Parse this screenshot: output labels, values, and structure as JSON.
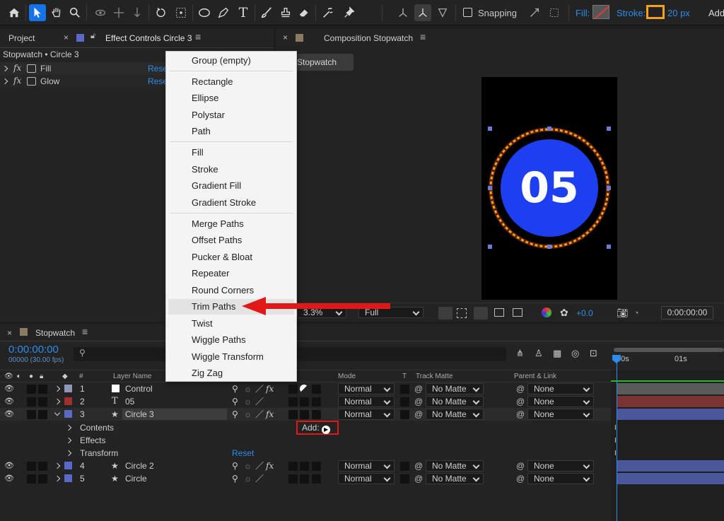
{
  "toolbar": {
    "snapping": "Snapping",
    "fill_label": "Fill:",
    "stroke_label": "Stroke:",
    "stroke_width": "20 px",
    "add_label": "Add",
    "fill_color": "#e23b3b",
    "stroke_color": "#f4a21a"
  },
  "project_panel": {
    "project_tab": "Project",
    "effect_tab": "Effect Controls Circle 3",
    "breadcrumb": "Stopwatch • Circle 3",
    "effects": [
      {
        "name": "Fill",
        "reset": "Reset"
      },
      {
        "name": "Glow",
        "reset": "Reset"
      }
    ]
  },
  "composition_panel": {
    "tab": "Composition Stopwatch",
    "sub_tab": "Stopwatch",
    "display_number": "05",
    "zoom_value": "3.3%",
    "resolution": "Full",
    "exposure": "+0.0",
    "timecode": "0:00:00:00",
    "circle_color": "#1d3ff0",
    "ring_color": "#f4a21a"
  },
  "context_menu": {
    "groups": [
      [
        "Group (empty)"
      ],
      [
        "Rectangle",
        "Ellipse",
        "Polystar",
        "Path"
      ],
      [
        "Fill",
        "Stroke",
        "Gradient Fill",
        "Gradient Stroke"
      ],
      [
        "Merge Paths",
        "Offset Paths",
        "Pucker & Bloat",
        "Repeater",
        "Round Corners",
        "Trim Paths",
        "Twist",
        "Wiggle Paths",
        "Wiggle Transform",
        "Zig Zag"
      ]
    ],
    "highlighted": "Trim Paths"
  },
  "timeline": {
    "tab": "Stopwatch",
    "timecode": "0:00:00:00",
    "fps": "00000 (30.00 fps)",
    "search_placeholder": "",
    "headers": {
      "num": "#",
      "layer_name": "Layer Name",
      "mode": "Mode",
      "t": "T",
      "track_matte": "Track Matte",
      "parent": "Parent & Link"
    },
    "layers": [
      {
        "num": "1",
        "name": "Control",
        "color": "#8f96b8",
        "type": "solid",
        "mode": "Normal",
        "matte": "No Matte",
        "parent": "None",
        "bar": "#5a5a5a"
      },
      {
        "num": "2",
        "name": "05",
        "color": "#a03030",
        "type": "text",
        "mode": "Normal",
        "matte": "No Matte",
        "parent": "None",
        "bar": "#7a3434"
      },
      {
        "num": "3",
        "name": "Circle 3",
        "color": "#5a68c8",
        "type": "shape",
        "mode": "Normal",
        "matte": "No Matte",
        "parent": "None",
        "bar": "#4a579a"
      },
      {
        "num": "4",
        "name": "Circle 2",
        "color": "#5a68c8",
        "type": "shape",
        "mode": "Normal",
        "matte": "No Matte",
        "parent": "None",
        "bar": "#4a579a"
      },
      {
        "num": "5",
        "name": "Circle",
        "color": "#5a68c8",
        "type": "shape",
        "mode": "Normal",
        "matte": "No Matte",
        "parent": "None",
        "bar": "#4a579a"
      }
    ],
    "sub_rows": {
      "contents": "Contents",
      "effects": "Effects",
      "transform": "Transform",
      "reset": "Reset",
      "add": "Add:"
    },
    "ruler": {
      "start": "00s",
      "second": "01s"
    }
  }
}
